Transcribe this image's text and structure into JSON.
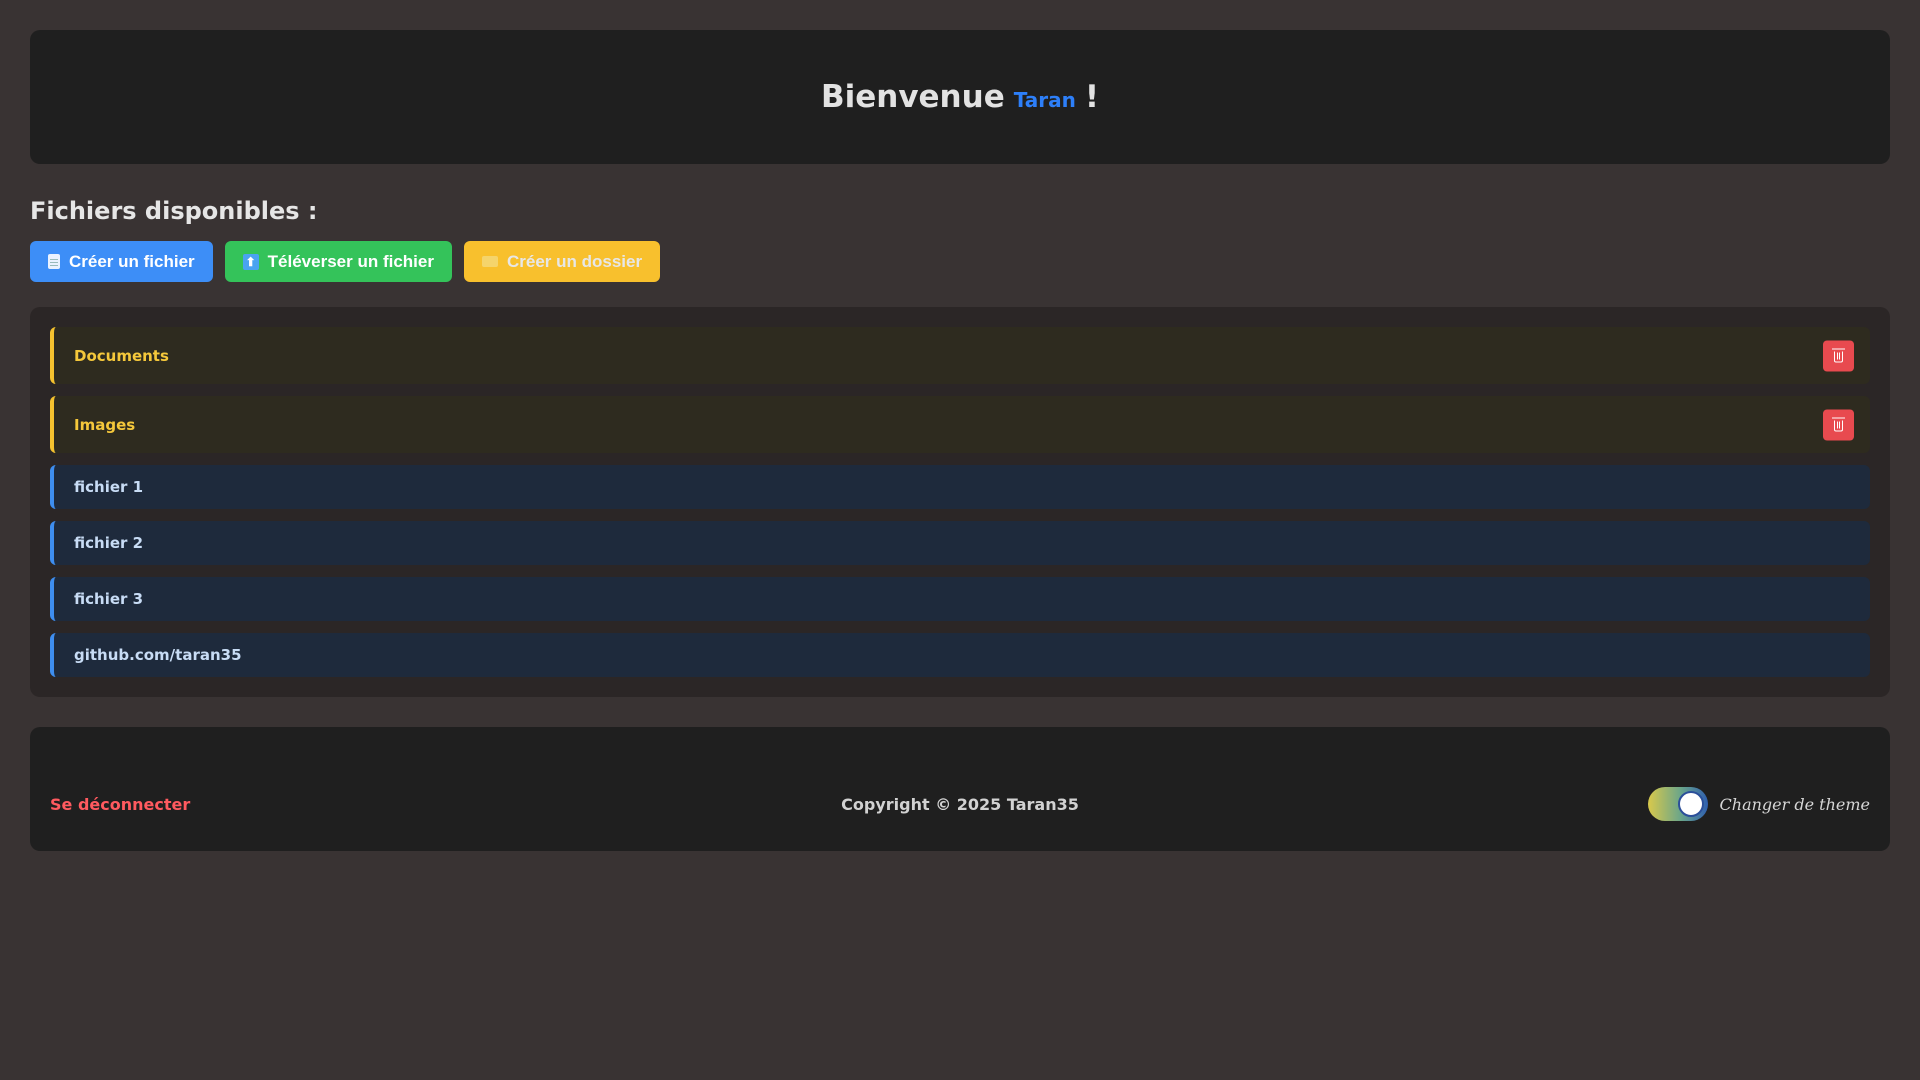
{
  "header": {
    "welcome_text": "Bienvenue",
    "username": "Taran",
    "exclaim": "!"
  },
  "section": {
    "title": "Fichiers disponibles :"
  },
  "actions": {
    "create_file": "Créer un fichier",
    "upload_file": "Téléverser un fichier",
    "create_folder": "Créer un dossier"
  },
  "folders": [
    {
      "name": "Documents"
    },
    {
      "name": "Images"
    }
  ],
  "files": [
    {
      "name": "fichier 1"
    },
    {
      "name": "fichier 2"
    },
    {
      "name": "fichier 3"
    },
    {
      "name": "github.com/taran35"
    }
  ],
  "footer": {
    "logout": "Se déconnecter",
    "copyright": "Copyright © 2025 Taran35",
    "theme_label": "Changer de theme",
    "theme_toggle_on": true
  },
  "colors": {
    "accent_blue": "#3d8ef7",
    "accent_green": "#34c35a",
    "accent_yellow": "#f8c02d",
    "danger": "#e84a4f",
    "username": "#2d7ff9"
  }
}
